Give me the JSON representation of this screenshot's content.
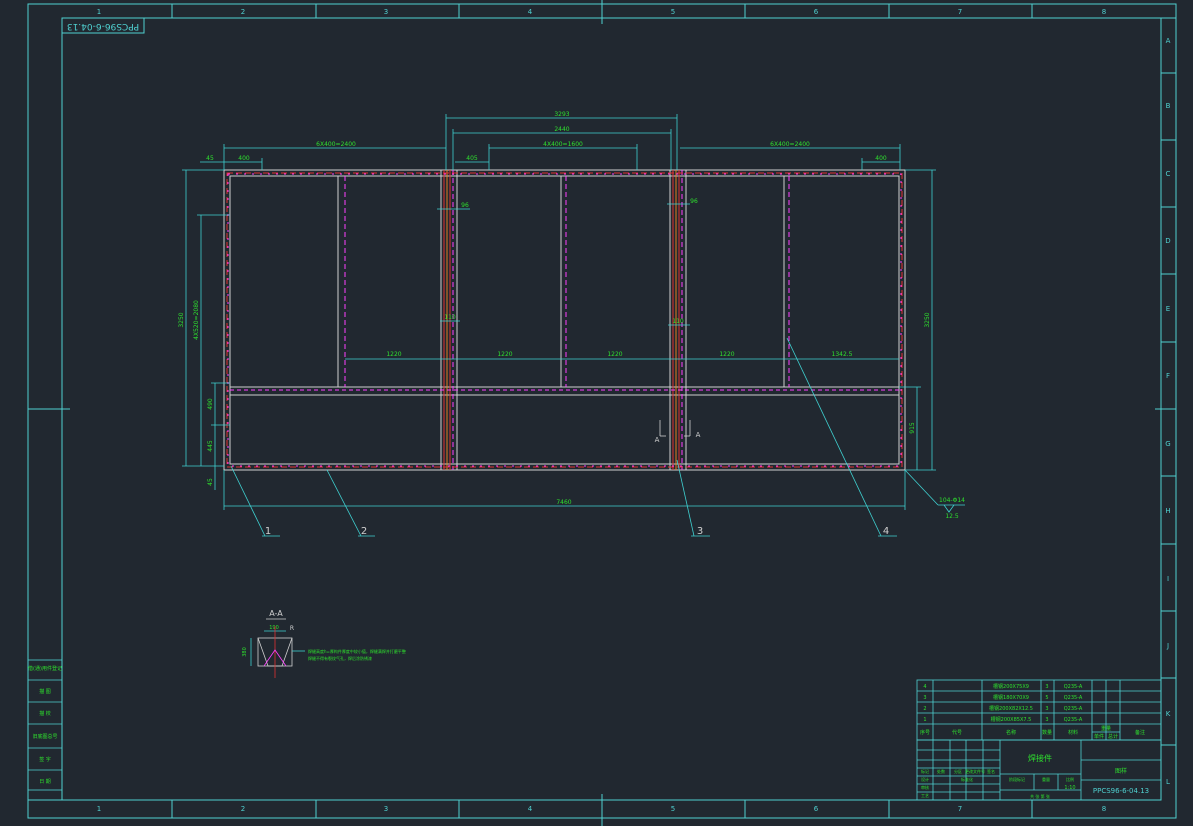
{
  "drawing": {
    "drawing_number_rotated": "PPCS96-6-04.13",
    "column_zones": [
      "1",
      "2",
      "3",
      "4",
      "5",
      "6",
      "7",
      "8"
    ],
    "row_zones": [
      "A",
      "B",
      "C",
      "D",
      "E",
      "F",
      "G",
      "H",
      "I",
      "J",
      "K",
      "L"
    ],
    "colors": {
      "background": "#212830",
      "frame": "#4fd0d0",
      "dimension": "#3fd0d0",
      "dimension_text": "#2ee02e",
      "beam": "#d0d0d0",
      "weld_red": "#e03030",
      "weld_magenta": "#ff40ff",
      "center_orange": "#e08020",
      "label": "#d0d0d0"
    }
  },
  "dimensions": {
    "overall_top": "3293",
    "inner_top": "2440",
    "pitch_left": "6X400=2400",
    "pitch_mid": "4X400=1600",
    "pitch_right": "6X400=2400",
    "edge_left": "45",
    "first_left": "400",
    "first_mid": "405",
    "first_right": "400",
    "gap_left": "96",
    "gap_right": "96",
    "gap_left_mid": "110",
    "gap_right_mid": "110",
    "bay_1": "1220",
    "bay_2": "1220",
    "bay_3": "1220",
    "bay_4": "1220",
    "bay_5": "1342.5",
    "overall_width": "7460",
    "height_outer_left": "3250",
    "height_pitch_left": "4X520=2080",
    "height_lower_1": "490",
    "height_lower_2": "445",
    "height_edge": "45",
    "height_right": "3250",
    "height_right_lower": "915",
    "weld_note": "104-Φ14",
    "weld_note_2": "12.5"
  },
  "callouts": [
    "1",
    "2",
    "3",
    "4"
  ],
  "section_marks": {
    "left": "A",
    "right": "A"
  },
  "detail": {
    "title": "A-A",
    "dim_top": "190",
    "dim_side": "380",
    "dim_r": "R",
    "note_line_1": "焊缝高度h=厚构件厚度中较小值，焊缝满焊并打磨平整",
    "note_line_2": "焊缝不得有裂纹气孔，焊后涂防锈漆"
  },
  "left_strip": [
    "借(通)用件登记",
    "描   图",
    "描   校",
    "旧底图总号",
    "签   字",
    "日   期"
  ],
  "parts_list": {
    "rows": [
      {
        "no": "4",
        "name": "槽钢200X75X9",
        "qty": "3",
        "material": "Q235-A"
      },
      {
        "no": "3",
        "name": "槽钢180X70X9",
        "qty": "5",
        "material": "Q235-A"
      },
      {
        "no": "2",
        "name": "槽钢200X82X12.5",
        "qty": "3",
        "material": "Q235-A"
      },
      {
        "no": "1",
        "name": "槽钢200X85X7.5",
        "qty": "3",
        "material": "Q235-A"
      }
    ],
    "header": [
      "序号",
      "代号",
      "名称",
      "数量",
      "材料",
      "单件",
      "总计",
      "备注"
    ],
    "header_weight": "重量"
  },
  "title_block": {
    "part_name": "焊接件",
    "company": "图样",
    "drawing_number": "PPCS96-6-04.13",
    "stage_label": "阶段标记",
    "weight_label": "重量",
    "scale_label": "比例",
    "scale_value": "1:10",
    "sheet_label": "共    张    第    张",
    "sign_rows": [
      "标记",
      "设计",
      "审核",
      "工艺",
      "批准"
    ],
    "date_cells": [
      "处数",
      "分区",
      "更改文件号",
      "签名",
      "年月日"
    ],
    "small_labels": [
      "标准化"
    ]
  }
}
